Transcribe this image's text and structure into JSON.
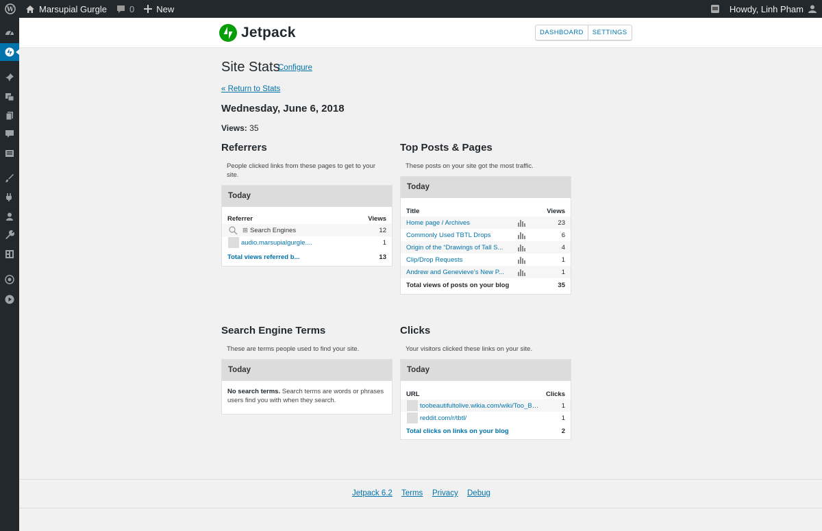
{
  "adminbar": {
    "site_name": "Marsupial Gurgle",
    "comments_count": "0",
    "new_label": "New",
    "howdy": "Howdy, Linh Pham"
  },
  "masthead": {
    "logo_text": "Jetpack",
    "nav": [
      "DASHBOARD",
      "SETTINGS"
    ]
  },
  "page": {
    "title": "Site Stats",
    "configure": "Configure",
    "return_link": "« Return to Stats",
    "date": "Wednesday, June 6, 2018",
    "views_label": "Views:",
    "views_value": "35"
  },
  "referrers": {
    "title": "Referrers",
    "description": "People clicked links from these pages to get to your site.",
    "box_title": "Today",
    "col_left": "Referrer",
    "col_right": "Views",
    "rows": [
      {
        "label": "Search Engines",
        "value": "12",
        "icon": "search-icon",
        "expand": "⊞"
      },
      {
        "label": "audio.marsupialgurgle....",
        "value": "1",
        "icon": "thumbnail"
      }
    ],
    "total_label": "Total views referred b...",
    "total_value": "13"
  },
  "top_posts": {
    "title": "Top Posts & Pages",
    "description": "These posts on your site got the most traffic.",
    "box_title": "Today",
    "col_left": "Title",
    "col_right": "Views",
    "rows": [
      {
        "label": "Home page / Archives",
        "value": "23"
      },
      {
        "label": "Commonly Used TBTL Drops",
        "value": "6"
      },
      {
        "label": "Origin of the “Drawings of Tall S...",
        "value": "4"
      },
      {
        "label": "Clip/Drop Requests",
        "value": "1"
      },
      {
        "label": "Andrew and Genevieve’s New P...",
        "value": "1"
      }
    ],
    "total_label": "Total views of posts on your blog",
    "total_value": "35"
  },
  "search_terms": {
    "title": "Search Engine Terms",
    "description": "These are terms people used to find your site.",
    "box_title": "Today",
    "empty_bold": "No search terms.",
    "empty_text": " Search terms are words or phrases users find you with when they search."
  },
  "clicks": {
    "title": "Clicks",
    "description": "Your visitors clicked these links on your site.",
    "box_title": "Today",
    "col_left": "URL",
    "col_right": "Clicks",
    "rows": [
      {
        "label": "toobeautifultolive.wikia.com/wiki/Too_Be...",
        "value": "1"
      },
      {
        "label": "reddit.com/r/tbtl/",
        "value": "1"
      }
    ],
    "total_label": "Total clicks on links on your blog",
    "total_value": "2"
  },
  "footer": {
    "version": "Jetpack 6.2",
    "terms": "Terms",
    "privacy": "Privacy",
    "debug": "Debug"
  },
  "colors": {
    "adminbar": "#23282d",
    "link": "#0073aa",
    "jetpack_green": "#069e08",
    "box_header": "#dcdcdc"
  }
}
